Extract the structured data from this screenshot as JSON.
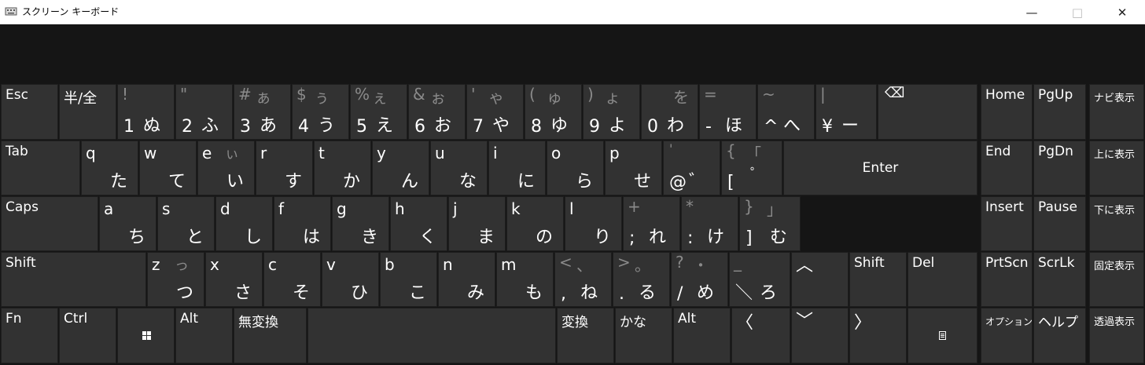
{
  "window": {
    "title": "スクリーン キーボード",
    "min": "—",
    "max": "□",
    "close": "✕"
  },
  "keys": {
    "esc": "Esc",
    "hankaku": "半/全",
    "k1_t": "!",
    "k1_b": "1",
    "k1_k": "ぬ",
    "k2_t": "\"",
    "k2_b": "2",
    "k2_k": "ふ",
    "k3_t": "#",
    "k3_t2": "ぁ",
    "k3_b": "3",
    "k3_k": "あ",
    "k4_t": "$",
    "k4_t2": "ぅ",
    "k4_b": "4",
    "k4_k": "う",
    "k5_t": "%",
    "k5_t2": "ぇ",
    "k5_b": "5",
    "k5_k": "え",
    "k6_t": "&",
    "k6_t2": "ぉ",
    "k6_b": "6",
    "k6_k": "お",
    "k7_t": "'",
    "k7_t2": "ゃ",
    "k7_b": "7",
    "k7_k": "や",
    "k8_t": "(",
    "k8_t2": "ゅ",
    "k8_b": "8",
    "k8_k": "ゆ",
    "k9_t": ")",
    "k9_t2": "ょ",
    "k9_b": "9",
    "k9_k": "よ",
    "k0_t2": "を",
    "k0_b": "0",
    "k0_k": "わ",
    "kminus_t": "=",
    "kminus_b": "-",
    "kminus_k": "ほ",
    "kcaret_t": "~",
    "kcaret_b": "^",
    "kcaret_k": "へ",
    "kyen_t": "|",
    "kyen_b": "¥",
    "kyen_k": "ー",
    "backspace": "⌫",
    "tab": "Tab",
    "q": "q",
    "q_k": "た",
    "w": "w",
    "w_k": "て",
    "e": "e",
    "e_t2": "ぃ",
    "e_k": "い",
    "r": "r",
    "r_k": "す",
    "t": "t",
    "t_k": "か",
    "y": "y",
    "y_k": "ん",
    "u": "u",
    "u_k": "な",
    "i": "i",
    "i_k": "に",
    "o": "o",
    "o_k": "ら",
    "p": "p",
    "p_k": "せ",
    "at_t": "'",
    "at_b": "@",
    "at_k": "゛",
    "lb_t": "{",
    "lb_t2": "「",
    "lb_b": "[",
    "lb_k": "゜",
    "enter": "Enter",
    "caps": "Caps",
    "a": "a",
    "a_k": "ち",
    "s": "s",
    "s_k": "と",
    "d": "d",
    "d_k": "し",
    "f": "f",
    "f_k": "は",
    "g": "g",
    "g_k": "き",
    "h": "h",
    "h_k": "く",
    "j": "j",
    "j_k": "ま",
    "k": "k",
    "k_k": "の",
    "l": "l",
    "l_k": "り",
    "semi_t": "+",
    "semi_b": ";",
    "semi_k": "れ",
    "colon_t": "*",
    "colon_b": ":",
    "colon_k": "け",
    "rb_t": "}",
    "rb_t2": "」",
    "rb_b": "]",
    "rb_k": "む",
    "shift": "Shift",
    "z": "z",
    "z_t2": "っ",
    "z_k": "つ",
    "x": "x",
    "x_k": "さ",
    "c": "c",
    "c_k": "そ",
    "v": "v",
    "v_k": "ひ",
    "b": "b",
    "b_k": "こ",
    "n": "n",
    "n_k": "み",
    "m": "m",
    "m_k": "も",
    "comma_t": "<",
    "comma_t2": "、",
    "comma_b": ",",
    "comma_k": "ね",
    "period_t": ">",
    "period_t2": "。",
    "period_b": ".",
    "period_k": "る",
    "slash_t": "?",
    "slash_t2": "・",
    "slash_b": "/",
    "slash_k": "め",
    "bs_t": "_",
    "bs_b": "＼",
    "bs_k": "ろ",
    "up": "︿",
    "shift_r": "Shift",
    "del": "Del",
    "fn": "Fn",
    "ctrl": "Ctrl",
    "alt": "Alt",
    "muhenkan": "無変換",
    "henkan": "変換",
    "kana": "かな",
    "alt_r": "Alt",
    "left": "〈",
    "down": "﹀",
    "right": "〉",
    "home": "Home",
    "pgup": "PgUp",
    "navi": "ナビ表示",
    "end": "End",
    "pgdn": "PgDn",
    "ue": "上に表示",
    "insert": "Insert",
    "pause": "Pause",
    "shita": "下に表示",
    "prtscn": "PrtScn",
    "scrlk": "ScrLk",
    "kotei": "固定表示",
    "option": "オプション",
    "help": "ヘルプ",
    "touka": "透過表示"
  }
}
